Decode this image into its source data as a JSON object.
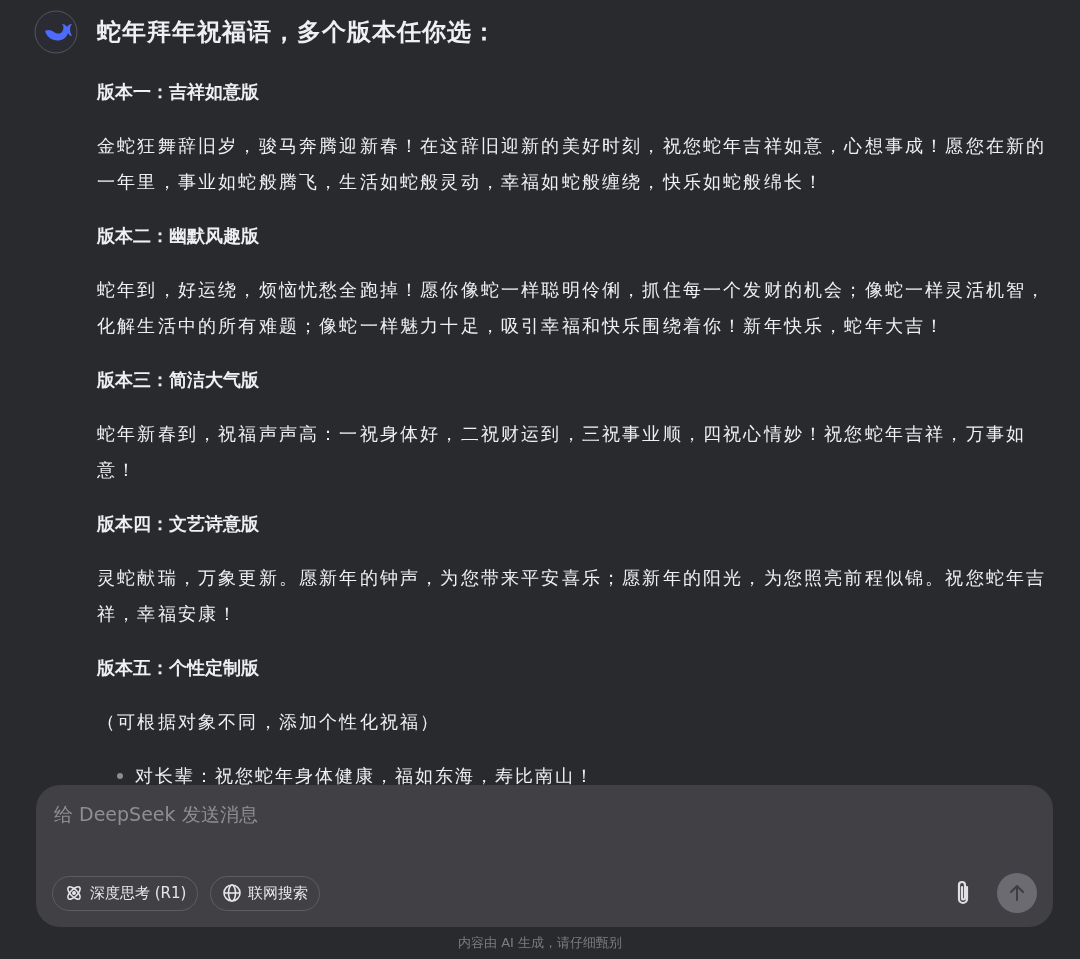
{
  "message": {
    "title": "蛇年拜年祝福语，多个版本任你选：",
    "blocks": [
      {
        "kind": "heading",
        "text": "版本一：吉祥如意版"
      },
      {
        "kind": "paragraph",
        "text": "金蛇狂舞辞旧岁，骏马奔腾迎新春！在这辞旧迎新的美好时刻，祝您蛇年吉祥如意，心想事成！愿您在新的一年里，事业如蛇般腾飞，生活如蛇般灵动，幸福如蛇般缠绕，快乐如蛇般绵长！"
      },
      {
        "kind": "heading",
        "text": "版本二：幽默风趣版"
      },
      {
        "kind": "paragraph",
        "text": "蛇年到，好运绕，烦恼忧愁全跑掉！愿你像蛇一样聪明伶俐，抓住每一个发财的机会；像蛇一样灵活机智，化解生活中的所有难题；像蛇一样魅力十足，吸引幸福和快乐围绕着你！新年快乐，蛇年大吉！"
      },
      {
        "kind": "heading",
        "text": "版本三：简洁大气版"
      },
      {
        "kind": "paragraph",
        "text": "蛇年新春到，祝福声声高：一祝身体好，二祝财运到，三祝事业顺，四祝心情妙！祝您蛇年吉祥，万事如意！"
      },
      {
        "kind": "heading",
        "text": "版本四：文艺诗意版"
      },
      {
        "kind": "paragraph",
        "text": "灵蛇献瑞，万象更新。愿新年的钟声，为您带来平安喜乐；愿新年的阳光，为您照亮前程似锦。祝您蛇年吉祥，幸福安康！"
      },
      {
        "kind": "heading",
        "text": "版本五：个性定制版"
      },
      {
        "kind": "paragraph",
        "text": "（可根据对象不同，添加个性化祝福）"
      },
      {
        "kind": "bullet",
        "text": "对长辈：祝您蛇年身体健康，福如东海，寿比南山！"
      }
    ]
  },
  "composer": {
    "placeholder": "给 DeepSeek 发送消息",
    "toggles": [
      {
        "kind": "think",
        "label": "深度思考 (R1)",
        "selected": false
      },
      {
        "kind": "search",
        "label": "联网搜索",
        "selected": false
      }
    ],
    "send_disabled": true
  },
  "footer": "内容由 AI 生成，请仔细甄别"
}
